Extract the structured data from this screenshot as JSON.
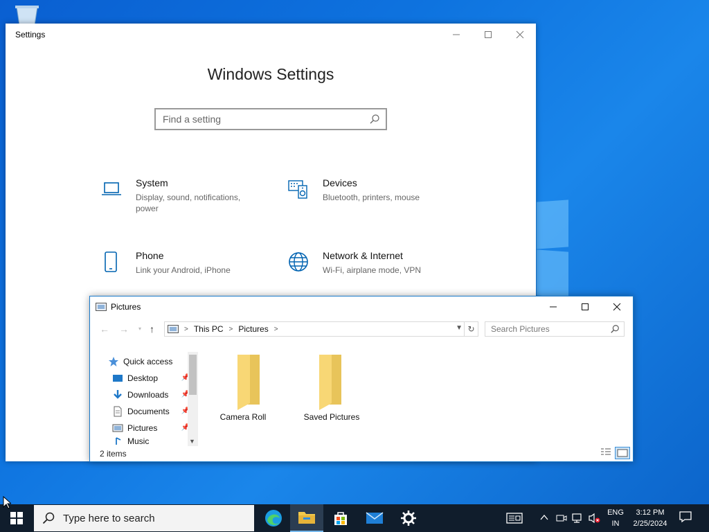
{
  "settings": {
    "window_title": "Settings",
    "heading": "Windows Settings",
    "search_placeholder": "Find a setting",
    "tiles": [
      {
        "name": "System",
        "desc": "Display, sound, notifications, power",
        "icon": "laptop-icon"
      },
      {
        "name": "Devices",
        "desc": "Bluetooth, printers, mouse",
        "icon": "devices-icon"
      },
      {
        "name": "Phone",
        "desc": "Link your Android, iPhone",
        "icon": "phone-icon"
      },
      {
        "name": "Network & Internet",
        "desc": "Wi-Fi, airplane mode, VPN",
        "icon": "globe-icon"
      }
    ]
  },
  "explorer": {
    "window_title": "Pictures",
    "breadcrumb": [
      "This PC",
      "Pictures"
    ],
    "search_placeholder": "Search Pictures",
    "nav": [
      {
        "label": "Quick access",
        "icon": "star-icon"
      },
      {
        "label": "Desktop",
        "icon": "desktop-icon",
        "pinned": true
      },
      {
        "label": "Downloads",
        "icon": "download-icon",
        "pinned": true
      },
      {
        "label": "Documents",
        "icon": "document-icon",
        "pinned": true
      },
      {
        "label": "Pictures",
        "icon": "pictures-icon",
        "pinned": true
      },
      {
        "label": "Music",
        "icon": "music-icon"
      }
    ],
    "folders": [
      "Camera Roll",
      "Saved Pictures"
    ],
    "status": "2 items"
  },
  "taskbar": {
    "search_placeholder": "Type here to search",
    "apps": [
      "edge-icon",
      "file-explorer-icon",
      "store-icon",
      "mail-icon",
      "settings-gear-icon"
    ],
    "lang_line1": "ENG",
    "lang_line2": "IN",
    "time": "3:12 PM",
    "date": "2/25/2024"
  },
  "colors": {
    "accent": "#0078d7",
    "icon_blue": "#0063b1",
    "taskbar": "#101d2c",
    "folder": "#f8d775"
  }
}
